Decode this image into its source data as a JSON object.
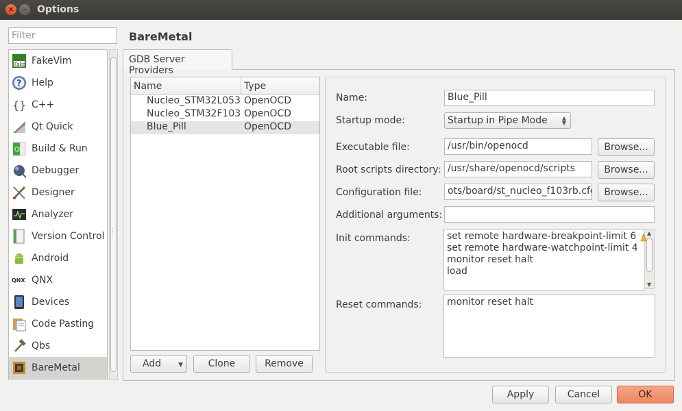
{
  "window": {
    "title": "Options"
  },
  "filter": {
    "placeholder": "Filter"
  },
  "categories": [
    {
      "label": "FakeVim",
      "icon": "fakevim-icon"
    },
    {
      "label": "Help",
      "icon": "help-icon"
    },
    {
      "label": "C++",
      "icon": "cpp-braces-icon"
    },
    {
      "label": "Qt Quick",
      "icon": "qt-quick-icon"
    },
    {
      "label": "Build & Run",
      "icon": "build-run-icon"
    },
    {
      "label": "Debugger",
      "icon": "debugger-icon"
    },
    {
      "label": "Designer",
      "icon": "designer-icon"
    },
    {
      "label": "Analyzer",
      "icon": "analyzer-icon"
    },
    {
      "label": "Version Control",
      "icon": "version-control-icon"
    },
    {
      "label": "Android",
      "icon": "android-icon"
    },
    {
      "label": "QNX",
      "icon": "qnx-icon"
    },
    {
      "label": "Devices",
      "icon": "devices-icon"
    },
    {
      "label": "Code Pasting",
      "icon": "code-pasting-icon"
    },
    {
      "label": "Qbs",
      "icon": "qbs-hammer-icon"
    },
    {
      "label": "BareMetal",
      "icon": "baremetal-chip-icon",
      "selected": true
    }
  ],
  "page": {
    "title": "BareMetal",
    "tab": "GDB Server Providers"
  },
  "providers": {
    "columns": [
      "Name",
      "Type"
    ],
    "rows": [
      {
        "name": "Nucleo_STM32L053",
        "type": "OpenOCD"
      },
      {
        "name": "Nucleo_STM32F103",
        "type": "OpenOCD"
      },
      {
        "name": "Blue_Pill",
        "type": "OpenOCD",
        "selected": true
      }
    ],
    "buttons": {
      "add": "Add",
      "clone": "Clone",
      "remove": "Remove"
    }
  },
  "form": {
    "name_label": "Name:",
    "name_value": "Blue_Pill",
    "startup_label": "Startup mode:",
    "startup_value": "Startup in Pipe Mode",
    "executable_label": "Executable file:",
    "executable_value": "/usr/bin/openocd",
    "root_label": "Root scripts directory:",
    "root_value": "/usr/share/openocd/scripts",
    "config_label": "Configuration file:",
    "config_value": "ots/board/st_nucleo_f103rb.cfg",
    "args_label": "Additional arguments:",
    "args_value": "",
    "init_label": "Init commands:",
    "init_lines": [
      "set remote hardware-breakpoint-limit 6",
      "set remote hardware-watchpoint-limit 4",
      "monitor reset halt",
      "load"
    ],
    "reset_label": "Reset commands:",
    "reset_lines": [
      "monitor reset halt"
    ],
    "browse": "Browse..."
  },
  "dialog_buttons": {
    "apply": "Apply",
    "cancel": "Cancel",
    "ok": "OK"
  }
}
